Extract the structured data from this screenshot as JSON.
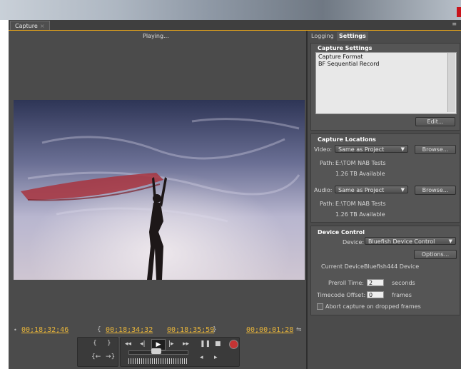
{
  "window": {
    "close_color": "#c8141b"
  },
  "panel": {
    "tab_label": "Capture",
    "tab_close": "×",
    "panel_menu_icon": "≡",
    "status": "Playing..."
  },
  "transport": {
    "in_point": "00;18;32;46",
    "in_marker": "•",
    "current_left": "00;18;34;32",
    "current_right": "00;18;35;59",
    "duration": "00;00;01;28",
    "accent": "#e8b53a"
  },
  "tabs": {
    "logging": "Logging",
    "settings": "Settings"
  },
  "capture_settings": {
    "title": "Capture Settings",
    "list": [
      "Capture Format",
      "BF Sequential Record"
    ],
    "edit_label": "Edit..."
  },
  "capture_locations": {
    "title": "Capture Locations",
    "video_label": "Video:",
    "video_value": "Same as Project",
    "audio_label": "Audio:",
    "audio_value": "Same as Project",
    "browse_label": "Browse...",
    "path_label": "Path:",
    "video_path": "E:\\TOM NAB Tests",
    "video_available": "1.26 TB Available",
    "audio_path": "E:\\TOM NAB Tests",
    "audio_available": "1.26 TB Available"
  },
  "device_control": {
    "title": "Device Control",
    "device_label": "Device:",
    "device_value": "Bluefish Device Control",
    "options_label": "Options...",
    "current_device_label": "Current Device:",
    "current_device_value": "Bluefish444 Device",
    "preroll_label": "Preroll Time:",
    "preroll_value": "2",
    "preroll_unit": "seconds",
    "timecode_label": "Timecode Offset:",
    "timecode_value": "0",
    "timecode_unit": "frames",
    "abort_label": "Abort capture on dropped frames",
    "abort_checked": false
  },
  "icons": {
    "play": "play-icon",
    "rewind": "rewind-icon",
    "fast_forward": "fast-forward-icon",
    "step_back": "step-back-icon",
    "step_forward": "step-forward-icon",
    "pause": "pause-icon",
    "stop": "stop-icon",
    "record": "record-icon"
  }
}
